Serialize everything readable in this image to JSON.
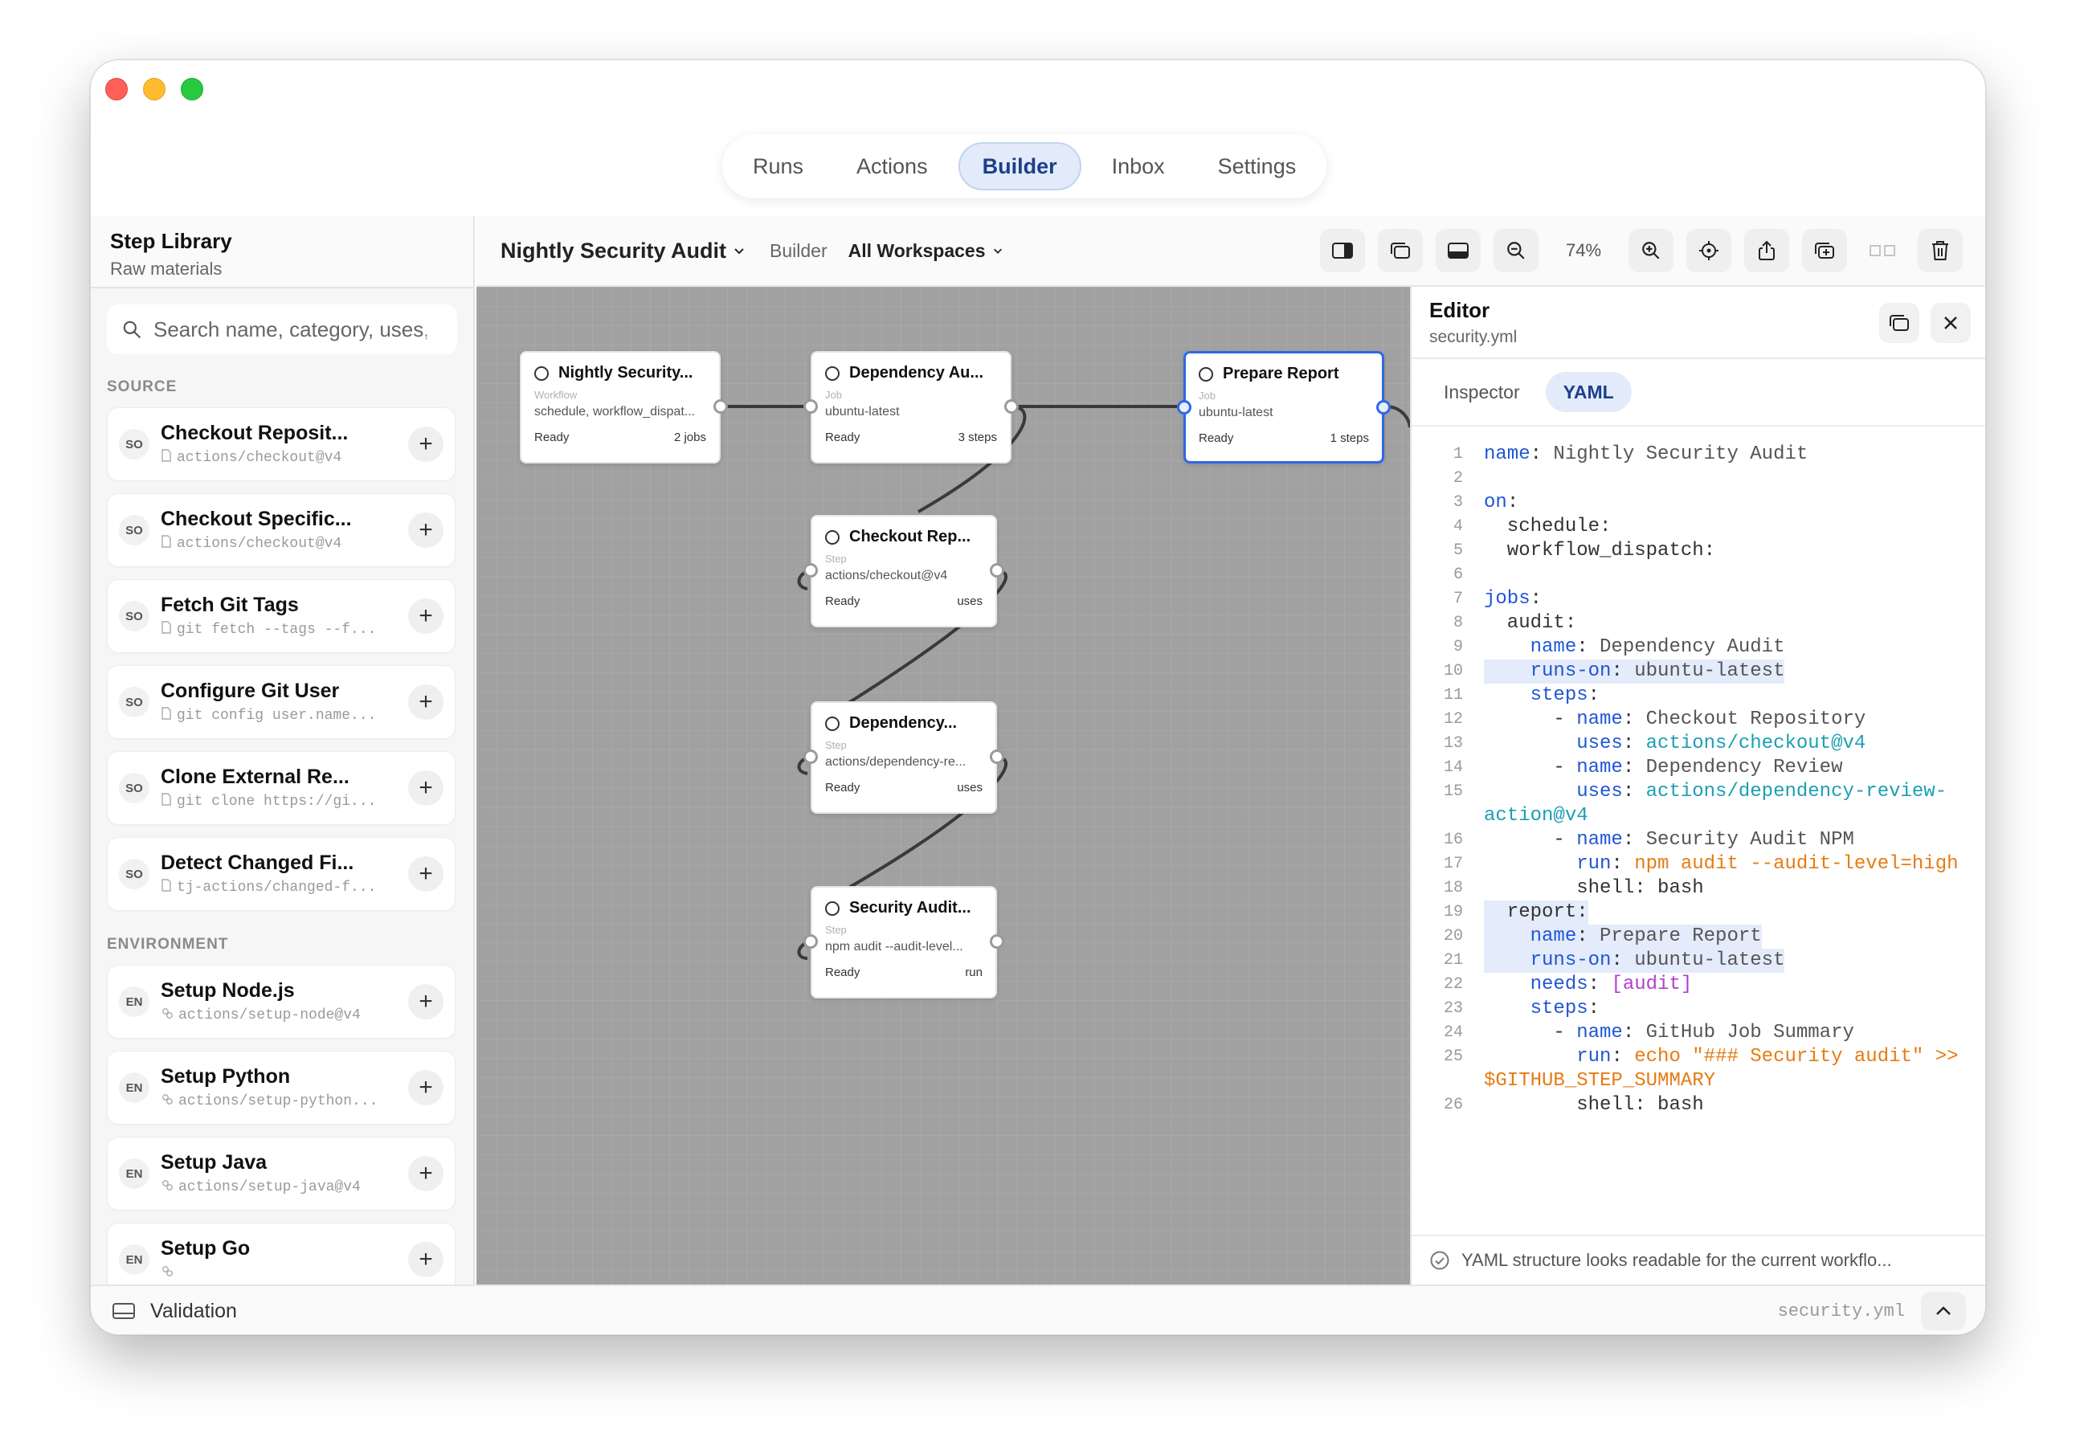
{
  "nav": {
    "tabs": [
      "Runs",
      "Actions",
      "Builder",
      "Inbox",
      "Settings"
    ],
    "active": "Builder"
  },
  "sidebar": {
    "title": "Step Library",
    "subtitle": "Raw materials",
    "search_placeholder": "Search name, category, uses, ...",
    "sections": [
      {
        "label": "SOURCE",
        "items": [
          {
            "badge": "SO",
            "name": "Checkout Reposit...",
            "sub": "actions/checkout@v4",
            "icon": "file-icon"
          },
          {
            "badge": "SO",
            "name": "Checkout Specific...",
            "sub": "actions/checkout@v4",
            "icon": "file-icon"
          },
          {
            "badge": "SO",
            "name": "Fetch Git Tags",
            "sub": "git fetch --tags --f...",
            "icon": "file-icon"
          },
          {
            "badge": "SO",
            "name": "Configure Git User",
            "sub": "git config user.name...",
            "icon": "file-icon"
          },
          {
            "badge": "SO",
            "name": "Clone External Re...",
            "sub": "git clone https://gi...",
            "icon": "file-icon"
          },
          {
            "badge": "SO",
            "name": "Detect Changed Fi...",
            "sub": "tj-actions/changed-f...",
            "icon": "file-icon"
          }
        ]
      },
      {
        "label": "ENVIRONMENT",
        "items": [
          {
            "badge": "EN",
            "name": "Setup Node.js",
            "sub": "actions/setup-node@v4",
            "icon": "link-icon"
          },
          {
            "badge": "EN",
            "name": "Setup Python",
            "sub": "actions/setup-python...",
            "icon": "link-icon"
          },
          {
            "badge": "EN",
            "name": "Setup Java",
            "sub": "actions/setup-java@v4",
            "icon": "link-icon"
          },
          {
            "badge": "EN",
            "name": "Setup Go",
            "sub": "",
            "icon": "link-icon"
          }
        ]
      }
    ]
  },
  "toolbar": {
    "workflow_title": "Nightly Security Audit",
    "builder_label": "Builder",
    "workspace": "All Workspaces",
    "zoom": "74%"
  },
  "nodes": [
    {
      "id": "n1",
      "title": "Nightly Security...",
      "kind": "Workflow",
      "detail": "schedule, workflow_dispat...",
      "status": "Ready",
      "meta": "2 jobs"
    },
    {
      "id": "n2",
      "title": "Dependency Au...",
      "kind": "Job",
      "detail": "ubuntu-latest",
      "status": "Ready",
      "meta": "3 steps"
    },
    {
      "id": "n3",
      "title": "Prepare Report",
      "kind": "Job",
      "detail": "ubuntu-latest",
      "status": "Ready",
      "meta": "1 steps"
    },
    {
      "id": "n4",
      "title": "Checkout Rep...",
      "kind": "Step",
      "detail": "actions/checkout@v4",
      "status": "Ready",
      "meta": "uses"
    },
    {
      "id": "n5",
      "title": "Dependency...",
      "kind": "Step",
      "detail": "actions/dependency-re...",
      "status": "Ready",
      "meta": "uses"
    },
    {
      "id": "n6",
      "title": "Security Audit...",
      "kind": "Step",
      "detail": "npm audit --audit-level...",
      "status": "Ready",
      "meta": "run"
    }
  ],
  "editor": {
    "title": "Editor",
    "file": "security.yml",
    "tabs": [
      "Inspector",
      "YAML"
    ],
    "active_tab": "YAML",
    "lines": [
      {
        "n": "1",
        "h": false,
        "t": [
          {
            "c": "k",
            "v": "name"
          },
          {
            "c": "lc",
            "v": ": "
          },
          {
            "c": "s",
            "v": "Nightly Security Audit"
          }
        ]
      },
      {
        "n": "2",
        "h": false,
        "t": []
      },
      {
        "n": "3",
        "h": false,
        "t": [
          {
            "c": "k",
            "v": "on"
          },
          {
            "c": "lc",
            "v": ":"
          }
        ]
      },
      {
        "n": "4",
        "h": false,
        "t": [
          {
            "c": "lc",
            "v": "  schedule:"
          }
        ]
      },
      {
        "n": "5",
        "h": false,
        "t": [
          {
            "c": "lc",
            "v": "  workflow_dispatch:"
          }
        ]
      },
      {
        "n": "6",
        "h": false,
        "t": []
      },
      {
        "n": "7",
        "h": false,
        "t": [
          {
            "c": "k",
            "v": "jobs"
          },
          {
            "c": "lc",
            "v": ":"
          }
        ]
      },
      {
        "n": "8",
        "h": false,
        "t": [
          {
            "c": "lc",
            "v": "  audit:"
          }
        ]
      },
      {
        "n": "9",
        "h": false,
        "t": [
          {
            "c": "lc",
            "v": "    "
          },
          {
            "c": "k",
            "v": "name"
          },
          {
            "c": "lc",
            "v": ": "
          },
          {
            "c": "s",
            "v": "Dependency Audit"
          }
        ]
      },
      {
        "n": "10",
        "h": true,
        "t": [
          {
            "c": "lc",
            "v": "    "
          },
          {
            "c": "k",
            "v": "runs-on"
          },
          {
            "c": "lc",
            "v": ": "
          },
          {
            "c": "s",
            "v": "ubuntu-latest"
          }
        ]
      },
      {
        "n": "11",
        "h": false,
        "t": [
          {
            "c": "lc",
            "v": "    "
          },
          {
            "c": "k",
            "v": "steps"
          },
          {
            "c": "lc",
            "v": ":"
          }
        ]
      },
      {
        "n": "12",
        "h": false,
        "t": [
          {
            "c": "lc",
            "v": "      - "
          },
          {
            "c": "k",
            "v": "name"
          },
          {
            "c": "lc",
            "v": ": "
          },
          {
            "c": "s",
            "v": "Checkout Repository"
          }
        ]
      },
      {
        "n": "13",
        "h": false,
        "t": [
          {
            "c": "lc",
            "v": "        "
          },
          {
            "c": "k",
            "v": "uses"
          },
          {
            "c": "lc",
            "v": ": "
          },
          {
            "c": "u",
            "v": "actions/checkout@v4"
          }
        ]
      },
      {
        "n": "14",
        "h": false,
        "t": [
          {
            "c": "lc",
            "v": "      - "
          },
          {
            "c": "k",
            "v": "name"
          },
          {
            "c": "lc",
            "v": ": "
          },
          {
            "c": "s",
            "v": "Dependency Review"
          }
        ]
      },
      {
        "n": "15",
        "h": false,
        "t": [
          {
            "c": "lc",
            "v": "        "
          },
          {
            "c": "k",
            "v": "uses"
          },
          {
            "c": "lc",
            "v": ": "
          },
          {
            "c": "u",
            "v": "actions/dependency-review-"
          }
        ]
      },
      {
        "n": "",
        "h": false,
        "t": [
          {
            "c": "u",
            "v": "action@v4"
          }
        ]
      },
      {
        "n": "16",
        "h": false,
        "t": [
          {
            "c": "lc",
            "v": "      - "
          },
          {
            "c": "k",
            "v": "name"
          },
          {
            "c": "lc",
            "v": ": "
          },
          {
            "c": "s",
            "v": "Security Audit NPM"
          }
        ]
      },
      {
        "n": "17",
        "h": false,
        "t": [
          {
            "c": "lc",
            "v": "        "
          },
          {
            "c": "k",
            "v": "run"
          },
          {
            "c": "lc",
            "v": ": "
          },
          {
            "c": "o",
            "v": "npm audit --audit-level=high"
          }
        ]
      },
      {
        "n": "18",
        "h": false,
        "t": [
          {
            "c": "lc",
            "v": "        shell: bash"
          }
        ]
      },
      {
        "n": "19",
        "h": true,
        "t": [
          {
            "c": "lc",
            "v": "  report:"
          }
        ]
      },
      {
        "n": "20",
        "h": true,
        "t": [
          {
            "c": "lc",
            "v": "    "
          },
          {
            "c": "k",
            "v": "name"
          },
          {
            "c": "lc",
            "v": ": "
          },
          {
            "c": "s",
            "v": "Prepare Report"
          }
        ]
      },
      {
        "n": "21",
        "h": true,
        "t": [
          {
            "c": "lc",
            "v": "    "
          },
          {
            "c": "k",
            "v": "runs-on"
          },
          {
            "c": "lc",
            "v": ": "
          },
          {
            "c": "s",
            "v": "ubuntu-latest"
          }
        ]
      },
      {
        "n": "22",
        "h": false,
        "t": [
          {
            "c": "lc",
            "v": "    "
          },
          {
            "c": "k",
            "v": "needs"
          },
          {
            "c": "lc",
            "v": ": "
          },
          {
            "c": "p",
            "v": "[audit]"
          }
        ]
      },
      {
        "n": "23",
        "h": false,
        "t": [
          {
            "c": "lc",
            "v": "    "
          },
          {
            "c": "k",
            "v": "steps"
          },
          {
            "c": "lc",
            "v": ":"
          }
        ]
      },
      {
        "n": "24",
        "h": false,
        "t": [
          {
            "c": "lc",
            "v": "      - "
          },
          {
            "c": "k",
            "v": "name"
          },
          {
            "c": "lc",
            "v": ": "
          },
          {
            "c": "s",
            "v": "GitHub Job Summary"
          }
        ]
      },
      {
        "n": "25",
        "h": false,
        "t": [
          {
            "c": "lc",
            "v": "        "
          },
          {
            "c": "k",
            "v": "run"
          },
          {
            "c": "lc",
            "v": ": "
          },
          {
            "c": "o",
            "v": "echo \"### Security audit\" >>"
          }
        ]
      },
      {
        "n": "",
        "h": false,
        "t": [
          {
            "c": "o",
            "v": "$GITHUB_STEP_SUMMARY"
          }
        ]
      },
      {
        "n": "26",
        "h": false,
        "t": [
          {
            "c": "lc",
            "v": "        shell: bash"
          }
        ]
      }
    ],
    "status": "YAML structure looks readable for the current workflo..."
  },
  "bottom": {
    "label": "Validation",
    "file": "security.yml"
  }
}
